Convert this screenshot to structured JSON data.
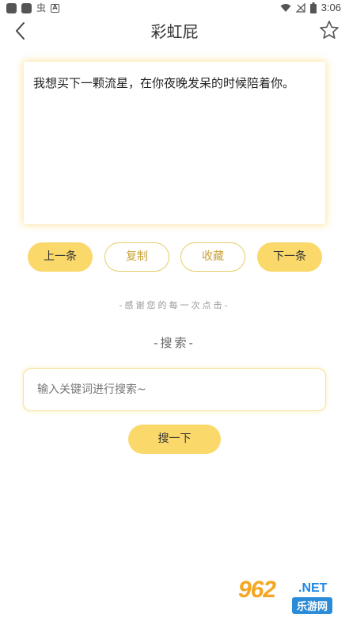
{
  "status_bar": {
    "time": "3:06",
    "glyph": "虫",
    "badge": "A"
  },
  "header": {
    "title": "彩虹屁",
    "back_icon": "chevron-left-icon",
    "star_icon": "star-outline-icon"
  },
  "quote": {
    "text": "我想买下一颗流星，在你夜晚发呆的时候陪着你。"
  },
  "buttons": {
    "prev": "上一条",
    "copy": "复制",
    "favorite": "收藏",
    "next": "下一条"
  },
  "thanks_text": "-感谢您的每一次点击-",
  "search": {
    "heading": "-搜索-",
    "placeholder": "输入关键词进行搜索~",
    "value": "",
    "button": "搜一下"
  },
  "watermark": {
    "number": "962",
    "suffix": ".NET",
    "cn": "乐游网"
  },
  "colors": {
    "accent": "#fad96a",
    "accent_text": "#c9a33a",
    "glow": "#fad669"
  }
}
